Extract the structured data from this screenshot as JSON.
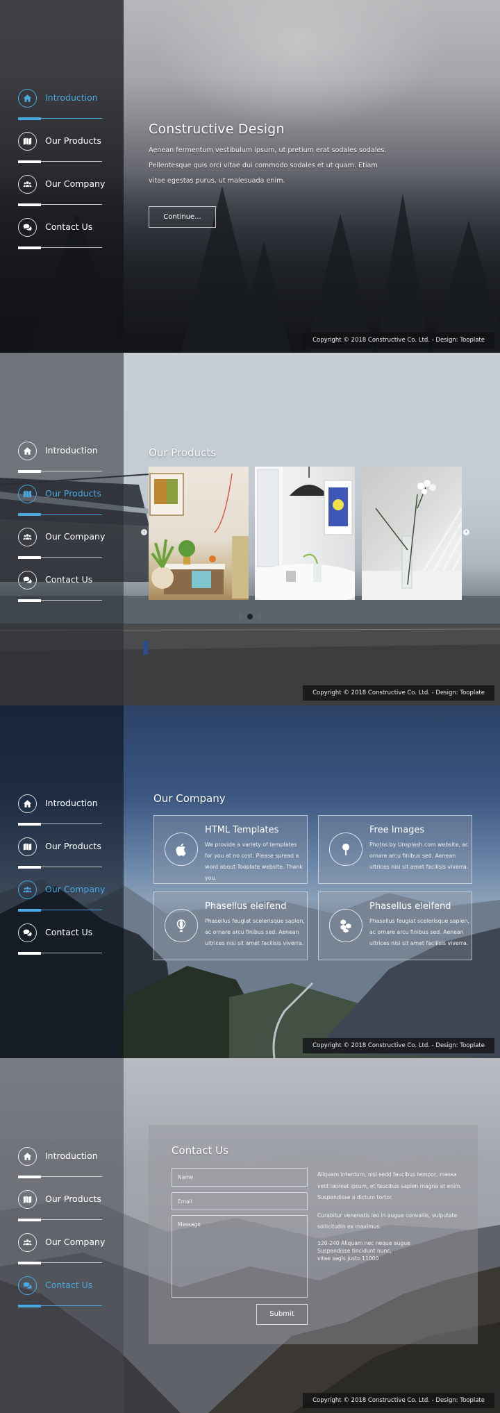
{
  "nav": {
    "items": [
      {
        "id": "introduction",
        "label": "Introduction",
        "icon": "home-icon"
      },
      {
        "id": "products",
        "label": "Our Products",
        "icon": "map-icon"
      },
      {
        "id": "company",
        "label": "Our Company",
        "icon": "users-icon"
      },
      {
        "id": "contact",
        "label": "Contact Us",
        "icon": "comments-icon"
      }
    ],
    "accent_color": "#4aa9e0"
  },
  "footer": {
    "copyright": "Copyright © 2018 Constructive Co. Ltd. - Design: Tooplate"
  },
  "intro": {
    "title": "Constructive Design",
    "body": "Aenean fermentum vestibulum ipsum, ut pretium erat sodales sodales. Pellentesque quis orci vitae dui commodo sodales et ut quam. Etiam vitae egestas purus, ut malesuada enim.",
    "button": "Continue..."
  },
  "products": {
    "title": "Our Products",
    "slides": [
      {
        "name": "living-room-plants"
      },
      {
        "name": "pendant-lamp-table"
      },
      {
        "name": "flower-vase"
      }
    ],
    "prev_icon": "chevron-left-icon",
    "next_icon": "chevron-right-icon",
    "active_dot": 2,
    "dot_count": 3
  },
  "company": {
    "title": "Our Company",
    "cards": [
      {
        "title": "HTML Templates",
        "text": "We provide a variety of templates for you at no cost. Please spread a word about Tooplate website. Thank you.",
        "icon": "apple-icon"
      },
      {
        "title": "Free Images",
        "text": "Photos by Unsplash.com website, ac ornare arcu finibus sed. Aenean ultrices nisi sit amet facilisis viverra.",
        "icon": "map-pin-icon"
      },
      {
        "title": "Phasellus eleifend",
        "text": "Phasellus feugiat scelerisque sapien, ac ornare arcu finibus sed. Aenean ultrices nisi sit amet facilisis viverra.",
        "icon": "hot-air-balloon-icon"
      },
      {
        "title": "Phasellus eleifend",
        "text": "Phasellus feugiat scelerisque sapien, ac ornare arcu finibus sed. Aenean ultrices nisi sit amet facilisis viverra.",
        "icon": "cubes-icon"
      }
    ]
  },
  "contact": {
    "title": "Contact Us",
    "name_placeholder": "Name",
    "email_placeholder": "Email",
    "message_placeholder": "Message",
    "submit": "Submit",
    "paragraph1": "Aliquam interdum, nisl sedd faucibus tempor, massa velit laoreet ipsum, et faucibus sapien magna at enim. Suspendisse a dictum tortor.",
    "paragraph2": "Curabitur venenatis leo in augue convallis, vulputate sollicitudin ex maximus.",
    "address_line1": "120-240 Aliquam nec neque augue",
    "address_line2": "Suspendisse tincidunt nunc,",
    "address_line3": "vitae sagis justo 11000"
  }
}
